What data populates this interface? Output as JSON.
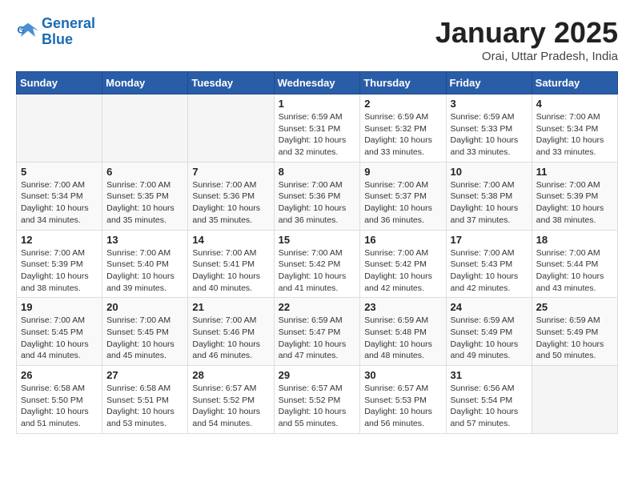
{
  "header": {
    "logo_line1": "General",
    "logo_line2": "Blue",
    "month": "January 2025",
    "location": "Orai, Uttar Pradesh, India"
  },
  "weekdays": [
    "Sunday",
    "Monday",
    "Tuesday",
    "Wednesday",
    "Thursday",
    "Friday",
    "Saturday"
  ],
  "weeks": [
    [
      {
        "day": "",
        "info": ""
      },
      {
        "day": "",
        "info": ""
      },
      {
        "day": "",
        "info": ""
      },
      {
        "day": "1",
        "info": "Sunrise: 6:59 AM\nSunset: 5:31 PM\nDaylight: 10 hours\nand 32 minutes."
      },
      {
        "day": "2",
        "info": "Sunrise: 6:59 AM\nSunset: 5:32 PM\nDaylight: 10 hours\nand 33 minutes."
      },
      {
        "day": "3",
        "info": "Sunrise: 6:59 AM\nSunset: 5:33 PM\nDaylight: 10 hours\nand 33 minutes."
      },
      {
        "day": "4",
        "info": "Sunrise: 7:00 AM\nSunset: 5:34 PM\nDaylight: 10 hours\nand 33 minutes."
      }
    ],
    [
      {
        "day": "5",
        "info": "Sunrise: 7:00 AM\nSunset: 5:34 PM\nDaylight: 10 hours\nand 34 minutes."
      },
      {
        "day": "6",
        "info": "Sunrise: 7:00 AM\nSunset: 5:35 PM\nDaylight: 10 hours\nand 35 minutes."
      },
      {
        "day": "7",
        "info": "Sunrise: 7:00 AM\nSunset: 5:36 PM\nDaylight: 10 hours\nand 35 minutes."
      },
      {
        "day": "8",
        "info": "Sunrise: 7:00 AM\nSunset: 5:36 PM\nDaylight: 10 hours\nand 36 minutes."
      },
      {
        "day": "9",
        "info": "Sunrise: 7:00 AM\nSunset: 5:37 PM\nDaylight: 10 hours\nand 36 minutes."
      },
      {
        "day": "10",
        "info": "Sunrise: 7:00 AM\nSunset: 5:38 PM\nDaylight: 10 hours\nand 37 minutes."
      },
      {
        "day": "11",
        "info": "Sunrise: 7:00 AM\nSunset: 5:39 PM\nDaylight: 10 hours\nand 38 minutes."
      }
    ],
    [
      {
        "day": "12",
        "info": "Sunrise: 7:00 AM\nSunset: 5:39 PM\nDaylight: 10 hours\nand 38 minutes."
      },
      {
        "day": "13",
        "info": "Sunrise: 7:00 AM\nSunset: 5:40 PM\nDaylight: 10 hours\nand 39 minutes."
      },
      {
        "day": "14",
        "info": "Sunrise: 7:00 AM\nSunset: 5:41 PM\nDaylight: 10 hours\nand 40 minutes."
      },
      {
        "day": "15",
        "info": "Sunrise: 7:00 AM\nSunset: 5:42 PM\nDaylight: 10 hours\nand 41 minutes."
      },
      {
        "day": "16",
        "info": "Sunrise: 7:00 AM\nSunset: 5:42 PM\nDaylight: 10 hours\nand 42 minutes."
      },
      {
        "day": "17",
        "info": "Sunrise: 7:00 AM\nSunset: 5:43 PM\nDaylight: 10 hours\nand 42 minutes."
      },
      {
        "day": "18",
        "info": "Sunrise: 7:00 AM\nSunset: 5:44 PM\nDaylight: 10 hours\nand 43 minutes."
      }
    ],
    [
      {
        "day": "19",
        "info": "Sunrise: 7:00 AM\nSunset: 5:45 PM\nDaylight: 10 hours\nand 44 minutes."
      },
      {
        "day": "20",
        "info": "Sunrise: 7:00 AM\nSunset: 5:45 PM\nDaylight: 10 hours\nand 45 minutes."
      },
      {
        "day": "21",
        "info": "Sunrise: 7:00 AM\nSunset: 5:46 PM\nDaylight: 10 hours\nand 46 minutes."
      },
      {
        "day": "22",
        "info": "Sunrise: 6:59 AM\nSunset: 5:47 PM\nDaylight: 10 hours\nand 47 minutes."
      },
      {
        "day": "23",
        "info": "Sunrise: 6:59 AM\nSunset: 5:48 PM\nDaylight: 10 hours\nand 48 minutes."
      },
      {
        "day": "24",
        "info": "Sunrise: 6:59 AM\nSunset: 5:49 PM\nDaylight: 10 hours\nand 49 minutes."
      },
      {
        "day": "25",
        "info": "Sunrise: 6:59 AM\nSunset: 5:49 PM\nDaylight: 10 hours\nand 50 minutes."
      }
    ],
    [
      {
        "day": "26",
        "info": "Sunrise: 6:58 AM\nSunset: 5:50 PM\nDaylight: 10 hours\nand 51 minutes."
      },
      {
        "day": "27",
        "info": "Sunrise: 6:58 AM\nSunset: 5:51 PM\nDaylight: 10 hours\nand 53 minutes."
      },
      {
        "day": "28",
        "info": "Sunrise: 6:57 AM\nSunset: 5:52 PM\nDaylight: 10 hours\nand 54 minutes."
      },
      {
        "day": "29",
        "info": "Sunrise: 6:57 AM\nSunset: 5:52 PM\nDaylight: 10 hours\nand 55 minutes."
      },
      {
        "day": "30",
        "info": "Sunrise: 6:57 AM\nSunset: 5:53 PM\nDaylight: 10 hours\nand 56 minutes."
      },
      {
        "day": "31",
        "info": "Sunrise: 6:56 AM\nSunset: 5:54 PM\nDaylight: 10 hours\nand 57 minutes."
      },
      {
        "day": "",
        "info": ""
      }
    ]
  ]
}
